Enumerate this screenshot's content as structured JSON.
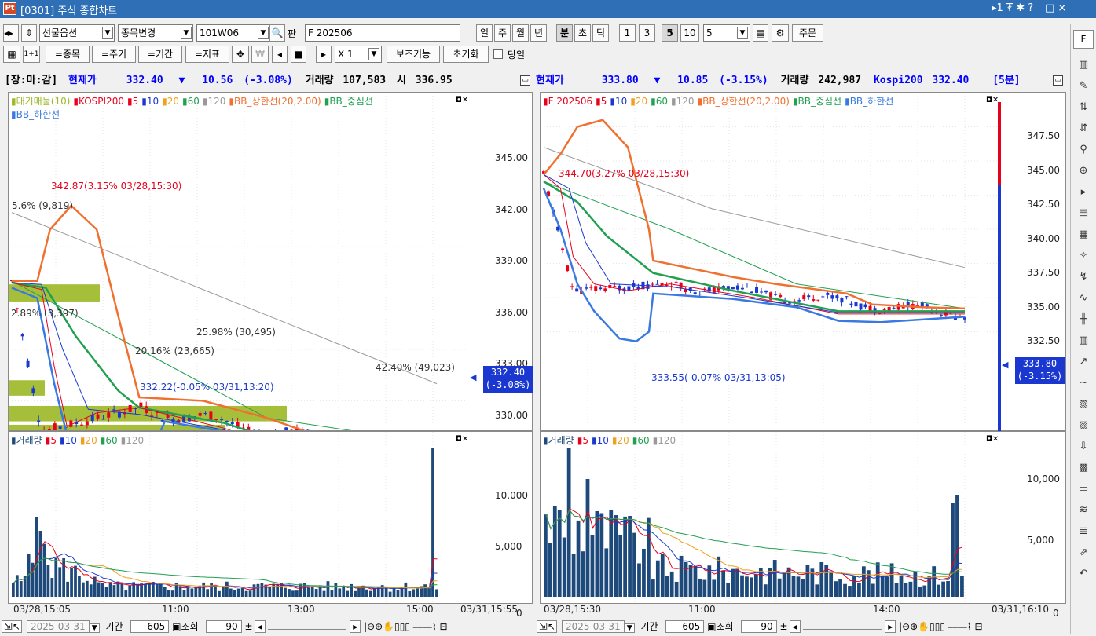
{
  "window": {
    "icon_text": "Pt",
    "title": "[0301] 주식 종합차트",
    "right_controls": "▸1 ₮ ✱ ? _ □ ×"
  },
  "toolbar1": {
    "market_select": "선물옵션",
    "change_btn": "종목변경",
    "code_input": "101W06",
    "pan_label": "판",
    "name_input": "F 202506",
    "periods": [
      "일",
      "주",
      "월",
      "년",
      "분",
      "초",
      "틱"
    ],
    "minutes": [
      "1",
      "3",
      "5",
      "10"
    ],
    "interval_input": "5",
    "order_btn": "주문"
  },
  "toolbar2": {
    "buttons": [
      "=종목",
      "=주기",
      "=기간",
      "=지표"
    ],
    "multiplier": "X 1",
    "aux_btn": "보조기능",
    "reset_btn": "초기화",
    "today_label": "당일"
  },
  "left_header": {
    "state": "[장:마:감]",
    "price_label": "현재가",
    "price": "332.40",
    "arrow": "▼",
    "change": "10.56",
    "change_pct": "(-3.08%)",
    "volume_label": "거래량",
    "volume": "107,583",
    "open_label": "시",
    "open": "336.95"
  },
  "right_header": {
    "price_label": "현재가",
    "price": "333.80",
    "arrow": "▼",
    "change": "10.85",
    "change_pct": "(-3.15%)",
    "volume_label": "거래량",
    "volume": "242,987",
    "index_label": "Kospi200",
    "index_value": "332.40",
    "period": "[5분]"
  },
  "left_price": {
    "legend1": [
      "대기매물(10)",
      "KOSPI200",
      "5",
      "10",
      "20",
      "60",
      "120",
      "BB_상한선(20,2.00)",
      "BB_중심선"
    ],
    "legend2": [
      "BB_하한선"
    ],
    "y_ticks": [
      "345.00",
      "342.00",
      "339.00",
      "336.00",
      "333.00",
      "330.00"
    ],
    "high_label": "342.87(3.15% 03/28,15:30)",
    "low_label": "332.22(-0.05% 03/31,13:20)",
    "last_price": "332.40",
    "last_pct": "(-3.08%)",
    "vp_labels": [
      "5.6% (9,819)",
      "2.89% (3,397)",
      "25.98% (30,495)",
      "20.16% (23,665)",
      "42.40% (49,023)"
    ]
  },
  "left_volume": {
    "legend": [
      "거래량",
      "5",
      "10",
      "20",
      "60",
      "120"
    ],
    "y_ticks": [
      "10,000",
      "5,000",
      "0"
    ],
    "x_ticks": [
      "03/28,15:05",
      "11:00",
      "13:00",
      "15:00",
      "03/31,15:55"
    ]
  },
  "right_price": {
    "legend1": [
      "F 202506",
      "5",
      "10",
      "20",
      "60",
      "120",
      "BB_상한선(20,2.00)",
      "BB_중심선",
      "BB_하한선"
    ],
    "y_ticks": [
      "347.50",
      "345.00",
      "342.50",
      "340.00",
      "337.50",
      "335.00",
      "332.50"
    ],
    "high_label": "344.70(3.27% 03/28,15:30)",
    "low_label": "333.55(-0.07% 03/31,13:05)",
    "last_price": "333.80",
    "last_pct": "(-3.15%)"
  },
  "right_volume": {
    "legend": [
      "거래량",
      "5",
      "10",
      "20",
      "60",
      "120"
    ],
    "y_ticks": [
      "10,000",
      "5,000",
      "0"
    ],
    "x_ticks": [
      "03/28,15:30",
      "11:00",
      "14:00",
      "03/31,16:10"
    ]
  },
  "bottom_left": {
    "date": "2025-03-31",
    "period_label": "기간",
    "period_value": "605",
    "query_label": "조회",
    "count": "90"
  },
  "bottom_right": {
    "date": "2025-03-31",
    "period_label": "기간",
    "period_value": "605",
    "query_label": "조회",
    "count": "90"
  },
  "sidebar": {
    "top_label": "F"
  },
  "colors": {
    "title_blue": "#2e6fb5",
    "up_red": "#e8001c",
    "down_blue": "#1a38d0",
    "bb_upper": "#f07030",
    "bb_mid": "#20a050",
    "bb_lower": "#3a7ae0",
    "ma120": "#999999",
    "volume_bar": "#1d4a7a",
    "vp_green": "#9cb826",
    "vp_blue": "#3a8ec8",
    "header_blue": "#0000ff"
  }
}
